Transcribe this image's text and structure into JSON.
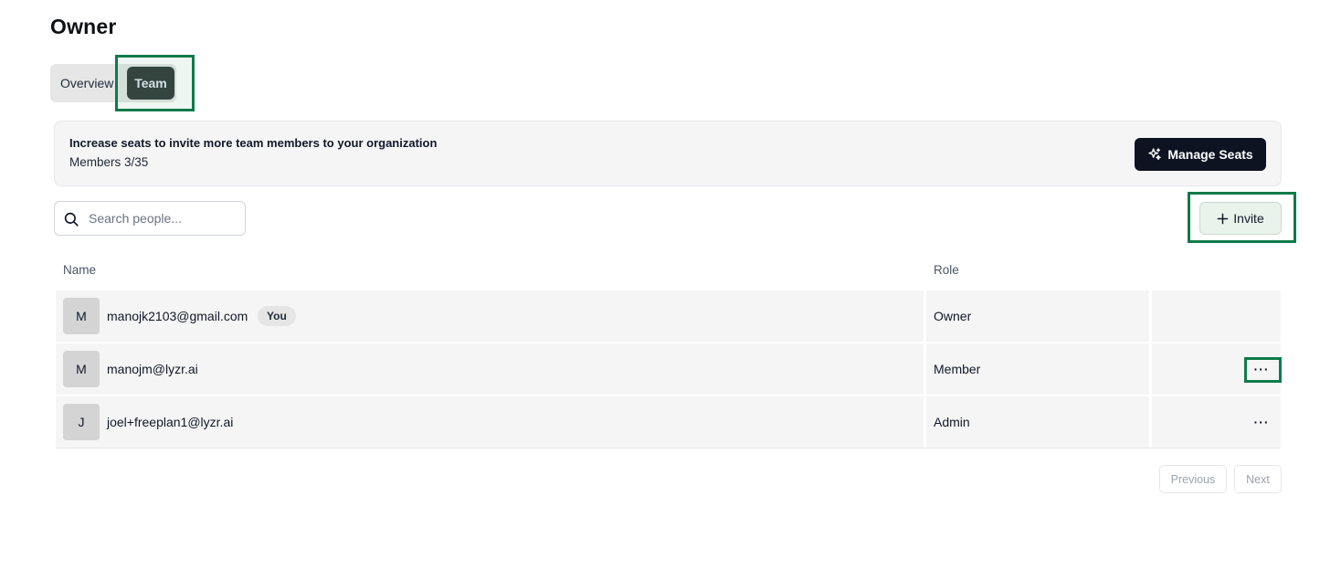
{
  "page": {
    "title": "Owner"
  },
  "tabs": [
    {
      "label": "Overview",
      "active": false
    },
    {
      "label": "Team",
      "active": true
    }
  ],
  "banner": {
    "title": "Increase seats to invite more team members to your organization",
    "members_text": "Members 3/35",
    "manage_button": {
      "label": "Manage Seats",
      "icon": "sparkle-icon"
    }
  },
  "search": {
    "placeholder": "Search people...",
    "value": "",
    "icon": "search-icon"
  },
  "invite_button": {
    "label": "Invite",
    "icon": "plus-icon"
  },
  "table": {
    "columns": [
      "Name",
      "Role"
    ],
    "rows": [
      {
        "initial": "M",
        "email": "manojk2103@gmail.com",
        "badge": "You",
        "role": "Owner",
        "has_actions": false
      },
      {
        "initial": "M",
        "email": "manojm@lyzr.ai",
        "badge": "",
        "role": "Member",
        "has_actions": true
      },
      {
        "initial": "J",
        "email": "joel+freeplan1@lyzr.ai",
        "badge": "",
        "role": "Admin",
        "has_actions": true
      }
    ],
    "actions_label": "···"
  },
  "pagination": {
    "previous": "Previous",
    "next": "Next"
  },
  "colors": {
    "highlight": "#0f7a4a",
    "primary_dark": "#0d1321",
    "active_tab": "#374140"
  }
}
